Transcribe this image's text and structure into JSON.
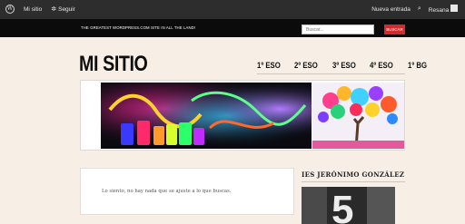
{
  "adminbar": {
    "site_name": "Mi sitio",
    "follow_label": "Seguir",
    "new_post_label": "Nueva entrada",
    "user_label": "Resana",
    "wp_icon": "wordpress-icon",
    "follow_icon": "gear-icon",
    "search_icon": "search-icon"
  },
  "header": {
    "tagline": "THE GREATEST WORDPRESS.COM SITE IN ALL THE LAND!",
    "search_placeholder": "Buscar...",
    "search_button": "BUSCAR",
    "accent_color": "#d32b2b"
  },
  "site": {
    "title": "MI SITIO"
  },
  "nav": {
    "items": [
      {
        "label": "1º ESO"
      },
      {
        "label": "2º ESO"
      },
      {
        "label": "3º ESO"
      },
      {
        "label": "4º ESO"
      },
      {
        "label": "1º BG"
      }
    ]
  },
  "content": {
    "message": "Lo siento, no hay nada que se ajuste a lo que buscas."
  },
  "sidebar": {
    "widget_title": "IES JERÓNIMO GONZÁLEZ"
  }
}
